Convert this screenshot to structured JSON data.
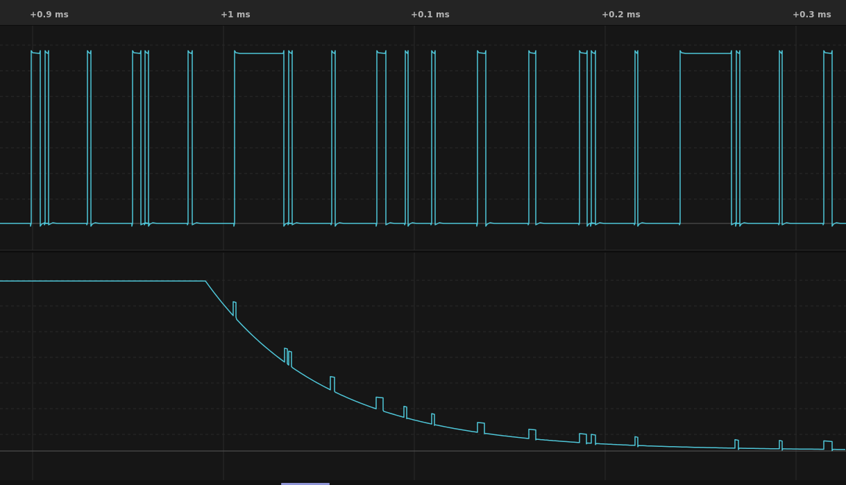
{
  "timeline": {
    "ticks": [
      {
        "label": "+0.9 ms"
      },
      {
        "label": "+1 ms"
      },
      {
        "label": "+0.1 ms"
      },
      {
        "label": "+0.2 ms"
      },
      {
        "label": "+0.3 ms"
      }
    ]
  },
  "colors": {
    "background": "#161616",
    "header": "#242424",
    "signal": "#4fc7d9",
    "grid": "#2b2b2b",
    "baseline": "#5a5a5a",
    "scrollbar": "#8f95d6"
  },
  "channels": {
    "digital": {
      "type": "digital",
      "pulses": [
        [
          45,
          58
        ],
        [
          65,
          70
        ],
        [
          126,
          131
        ],
        [
          191,
          203
        ],
        [
          209,
          214
        ],
        [
          271,
          277
        ],
        [
          338,
          409
        ],
        [
          416,
          421
        ],
        [
          478,
          483
        ],
        [
          543,
          556
        ],
        [
          584,
          588
        ],
        [
          622,
          627
        ],
        [
          688,
          700
        ],
        [
          762,
          772
        ],
        [
          835,
          846
        ],
        [
          852,
          858
        ],
        [
          915,
          919
        ],
        [
          980,
          1054
        ],
        [
          1061,
          1066
        ],
        [
          1123,
          1127
        ],
        [
          1187,
          1199
        ]
      ]
    },
    "analog": {
      "type": "analog",
      "pulses": [
        [
          336,
          340
        ],
        [
          410,
          414
        ],
        [
          416,
          420
        ],
        [
          476,
          482
        ],
        [
          542,
          552
        ],
        [
          582,
          586
        ],
        [
          622,
          626
        ],
        [
          688,
          698
        ],
        [
          762,
          772
        ],
        [
          835,
          845
        ],
        [
          852,
          858
        ],
        [
          915,
          919
        ],
        [
          1059,
          1064
        ],
        [
          1123,
          1127
        ],
        [
          1187,
          1199
        ]
      ]
    }
  },
  "scrollbar": {
    "position_percent": 33
  }
}
